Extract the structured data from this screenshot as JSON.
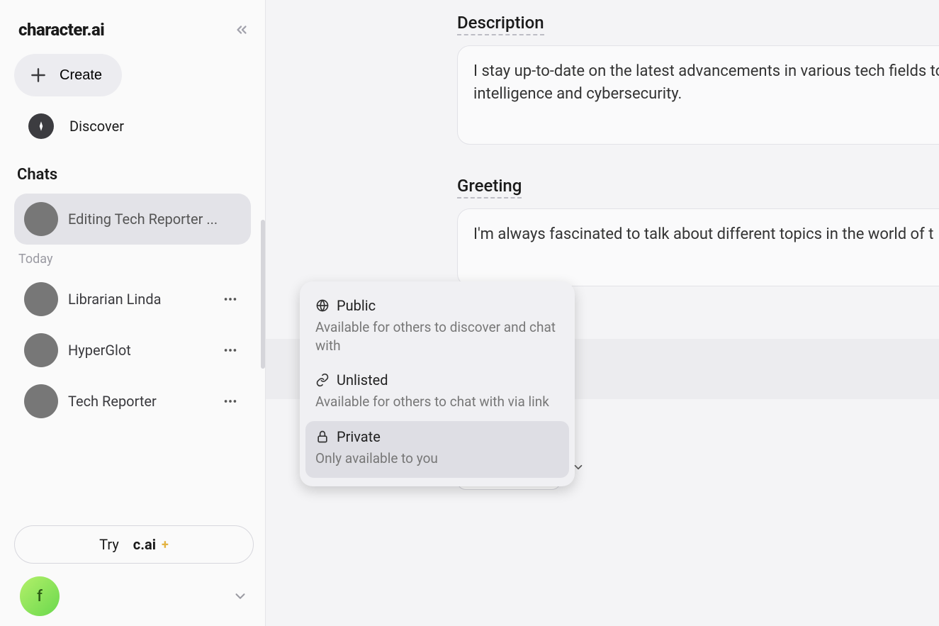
{
  "app": {
    "logo": "character.ai"
  },
  "sidebar": {
    "create_label": "Create",
    "discover_label": "Discover",
    "chats_title": "Chats",
    "today_label": "Today",
    "active_chat": {
      "name": "Editing Tech Reporter ..."
    },
    "items": [
      {
        "name": "Librarian Linda"
      },
      {
        "name": "HyperGlot"
      },
      {
        "name": "Tech Reporter"
      }
    ],
    "try_label": "Try",
    "try_brand": "c.ai",
    "user_initial": "f"
  },
  "form": {
    "description_label": "Description",
    "description_value": "I stay up-to-date on the latest advancements in various tech fields to artificial intelligence and cybersecurity.",
    "greeting_label": "Greeting",
    "greeting_value": "I'm always fascinated to talk about different topics in the world of t"
  },
  "visibility": {
    "selected_label": "Private",
    "options": [
      {
        "title": "Public",
        "desc": "Available for others to discover and chat with"
      },
      {
        "title": "Unlisted",
        "desc": "Available for others to chat with via link"
      },
      {
        "title": "Private",
        "desc": "Only available to you"
      }
    ]
  }
}
